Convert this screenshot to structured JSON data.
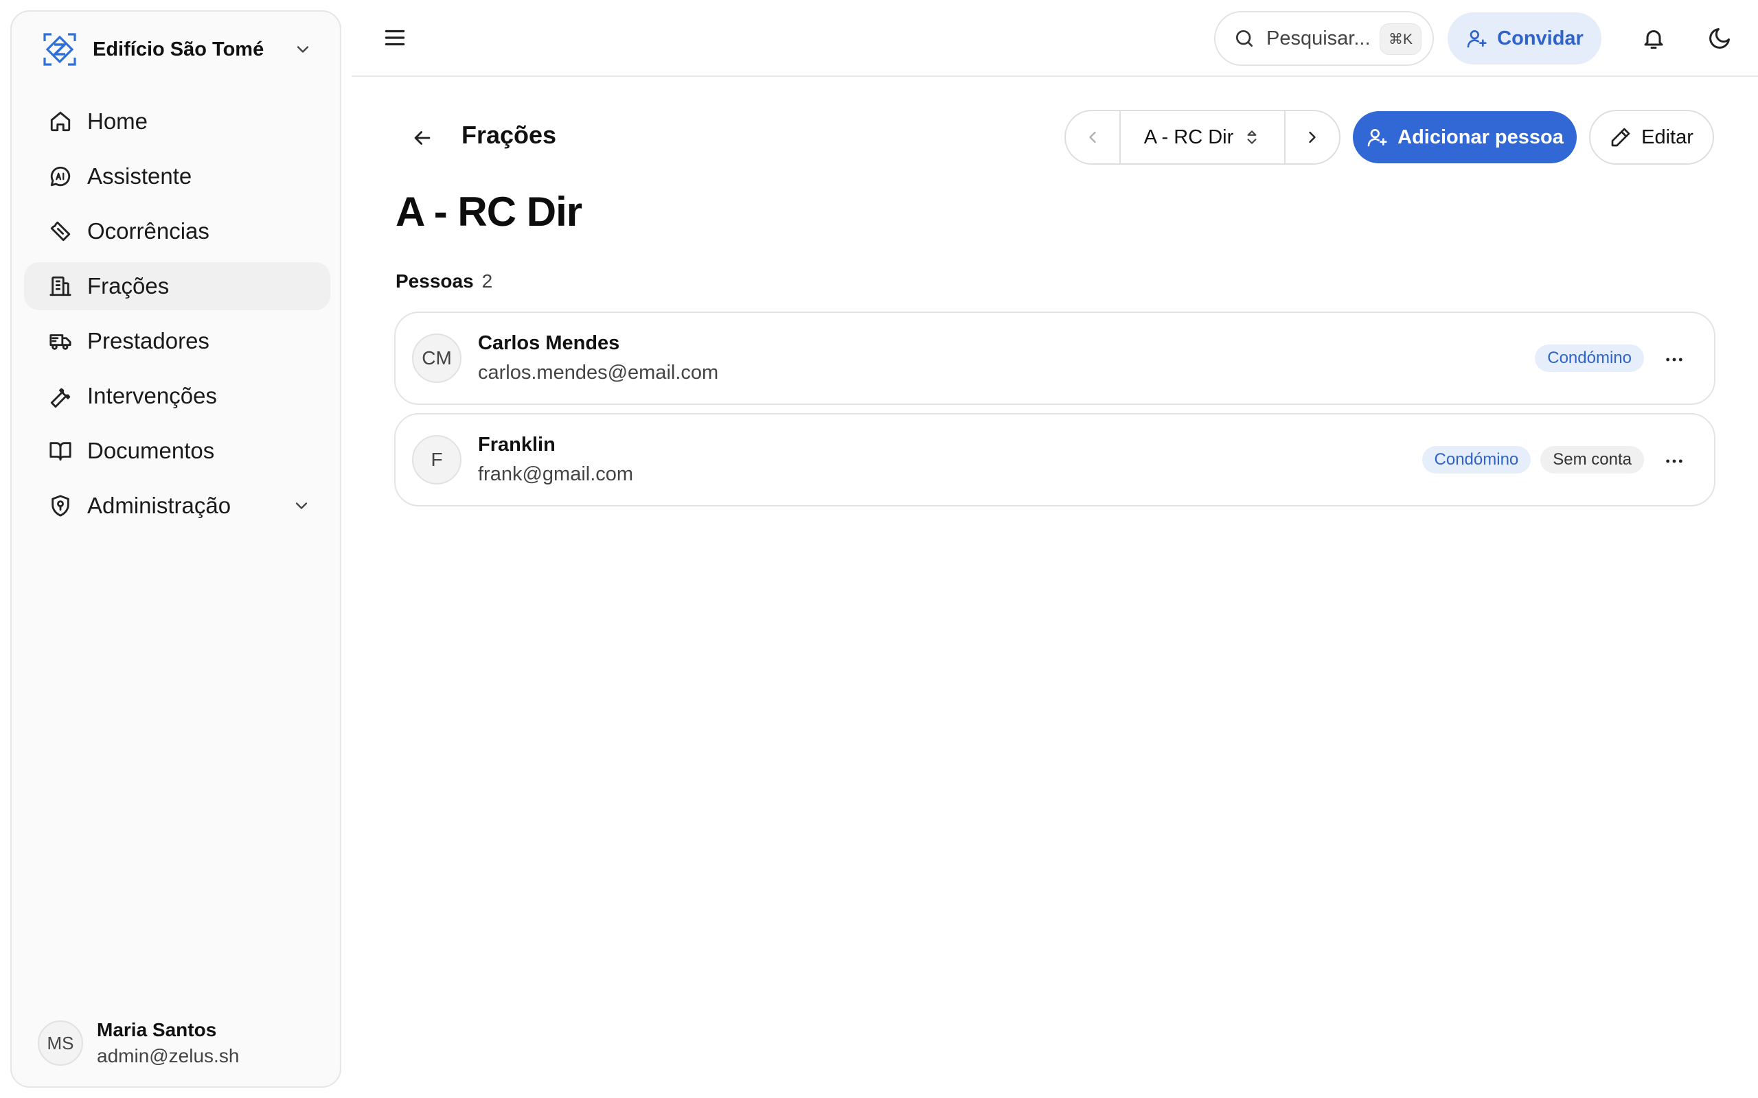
{
  "sidebar": {
    "org_name": "Edifício São Tomé",
    "items": [
      {
        "label": "Home",
        "icon": "home-icon"
      },
      {
        "label": "Assistente",
        "icon": "ai-chat-icon"
      },
      {
        "label": "Ocorrências",
        "icon": "ticket-icon"
      },
      {
        "label": "Frações",
        "icon": "building-icon"
      },
      {
        "label": "Prestadores",
        "icon": "truck-icon"
      },
      {
        "label": "Intervenções",
        "icon": "wrench-icon"
      },
      {
        "label": "Documentos",
        "icon": "book-icon"
      },
      {
        "label": "Administração",
        "icon": "shield-icon"
      }
    ],
    "active_item": "Frações",
    "user": {
      "initials": "MS",
      "name": "Maria Santos",
      "email": "admin@zelus.sh"
    }
  },
  "topbar": {
    "search_placeholder": "Pesquisar...",
    "search_shortcut": "⌘K",
    "invite_label": "Convidar"
  },
  "header": {
    "breadcrumb": "Frações",
    "current_unit": "A - RC Dir",
    "add_person_label": "Adicionar pessoa",
    "edit_label": "Editar"
  },
  "page": {
    "title": "A - RC Dir",
    "people_label": "Pessoas",
    "people_count": "2"
  },
  "people": [
    {
      "initials": "CM",
      "name": "Carlos Mendes",
      "email": "carlos.mendes@email.com",
      "badges": [
        "Condómino"
      ]
    },
    {
      "initials": "F",
      "name": "Franklin",
      "email": "frank@gmail.com",
      "badges": [
        "Condómino",
        "Sem conta"
      ]
    }
  ],
  "colors": {
    "accent": "#3168d6",
    "accent_soft": "#e5edfb",
    "badge_role_text": "#2f63c9",
    "border": "#e4e4e4",
    "sidebar_bg": "#fafafa"
  }
}
